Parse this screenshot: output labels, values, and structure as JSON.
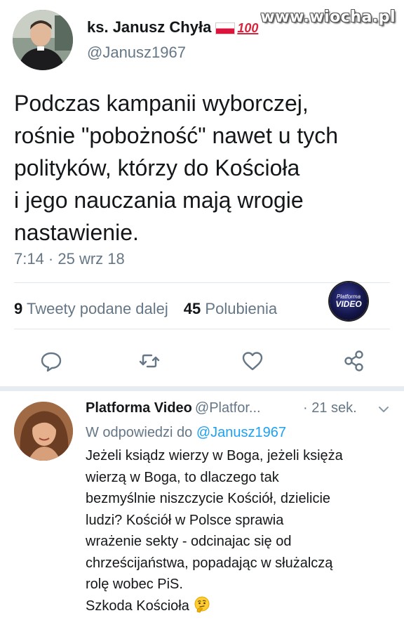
{
  "watermark": "www.wiocha.pl",
  "tweet": {
    "author_name": "ks. Janusz Chyła",
    "author_badge": "100",
    "author_handle": "@Janusz1967",
    "body_lines": [
      "Podczas kampanii wyborczej,",
      "rośnie \"pobożność\" nawet u tych",
      "polityków, którzy do Kościoła",
      "i jego nauczania mają wrogie",
      "nastawienie."
    ],
    "timestamp": "7:14 · 25 wrz 18",
    "retweets_count": "9",
    "retweets_label": "Tweety podane dalej",
    "likes_count": "45",
    "likes_label": "Polubienia",
    "logo_small": "Platforma",
    "logo_main": "VIDEO",
    "actions": [
      "reply-icon",
      "retweet-icon",
      "like-icon",
      "share-icon"
    ]
  },
  "reply": {
    "author_name": "Platforma Video",
    "author_handle": "@Platfor...",
    "time": "· 21 sek.",
    "reply_to_prefix": "W odpowiedzi do",
    "reply_to_handle": "@Janusz1967",
    "body_lines": [
      "Jeżeli ksiądz wierzy w Boga, jeżeli księża",
      "wierzą w Boga, to dlaczego tak",
      "bezmyślnie niszczycie Kościół, dzielicie",
      "ludzi? Kościół w Polsce sprawia",
      "wrażenie sekty - odcinajac się od",
      "chrześcijaństwa, popadając w służalczą",
      "rolę wobec PiS.",
      "Szkoda Kościoła"
    ]
  },
  "colors": {
    "text": "#14171a",
    "muted": "#657786",
    "link": "#1da1f2",
    "divider": "#e1e8ed",
    "separator": "#e6ecf0"
  }
}
